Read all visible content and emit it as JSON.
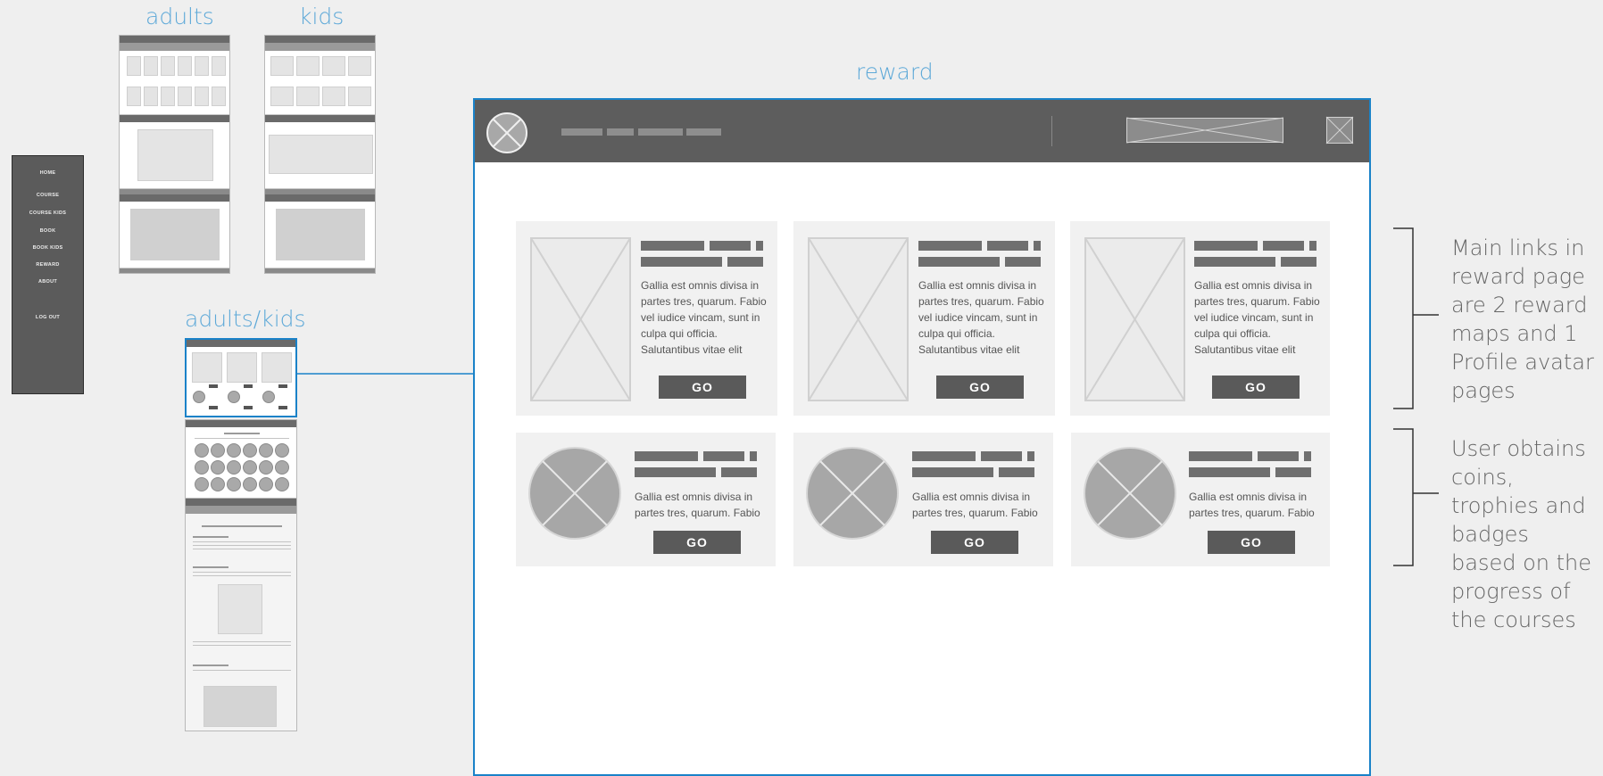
{
  "labels": {
    "adults": "adults",
    "kids": "kids",
    "adults_kids": "adults/kids",
    "reward": "reward"
  },
  "menu": {
    "items": [
      "HOME",
      "COURSE",
      "COURSE KIDS",
      "BOOK",
      "BOOK KIDS",
      "REWARD",
      "ABOUT",
      "LOG OUT"
    ]
  },
  "cards": {
    "text_long": "Gallia est omnis divisa in partes tres, quarum. Fabio vel iudice vincam, sunt in culpa qui officia. Salutantibus vitae elit",
    "text_short": "Gallia est omnis divisa in partes tres, quarum. Fabio",
    "go_label": "GO"
  },
  "notes": {
    "note1": "Main links in reward page are 2 reward maps and 1 Profile avatar pages",
    "note2": "User obtains coins, trophies and badges based on the progress of the courses"
  },
  "colors": {
    "accent": "#5ea9d8",
    "frame_border": "#1a82c8",
    "dark_bar": "#5d5d5d"
  }
}
